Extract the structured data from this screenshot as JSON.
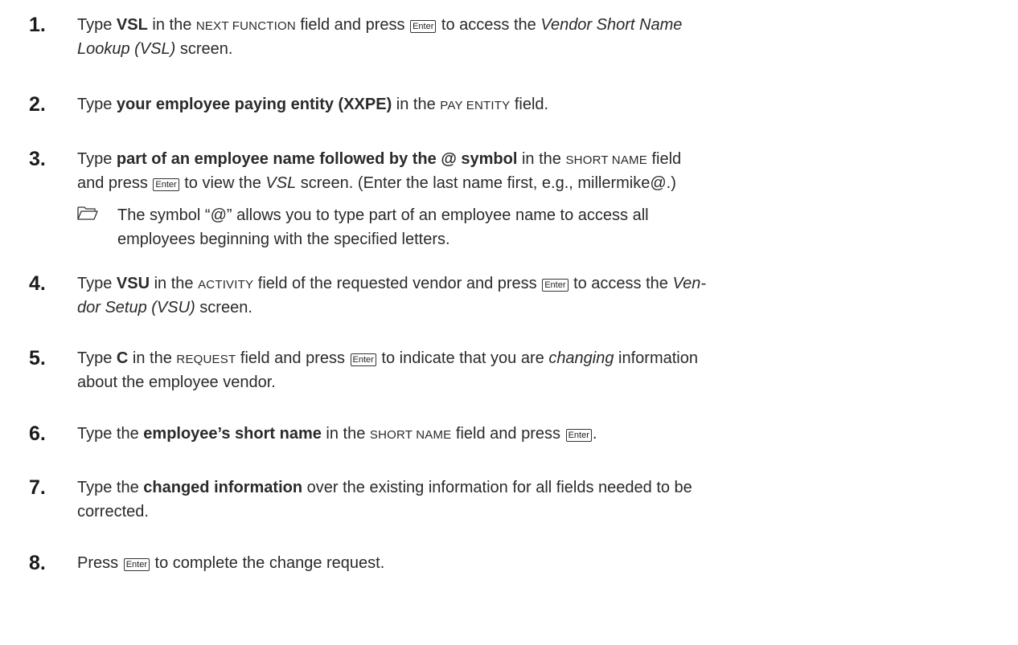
{
  "steps": [
    {
      "num": "1.",
      "parts": [
        "Type ",
        "VSL",
        " in the ",
        "NEXT FUNCTION",
        " field and press ",
        "Enter",
        " to access the ",
        "Vendor Short Name",
        "Lookup (VSL)",
        " screen."
      ]
    },
    {
      "num": "2.",
      "parts": [
        "Type ",
        "your employee paying entity (XXPE)",
        " in the ",
        "PAY ENTITY",
        " field."
      ]
    },
    {
      "num": "3.",
      "parts": [
        "Type ",
        "part of an employee name followed by the @ symbol",
        " in the ",
        "SHORT NAME",
        " field",
        "and press ",
        "Enter",
        " to view the ",
        "VSL",
        " screen.  (Enter the last name first, e.g., millermike@.)"
      ],
      "note": {
        "icon": "folder-icon",
        "line1": "The symbol “@” allows you to type part of an employee name to access all",
        "line2": "employees beginning with the specified letters."
      }
    },
    {
      "num": "4.",
      "parts": [
        "Type ",
        "VSU",
        " in the ",
        "ACTIVITY",
        " field of the requested vendor and press ",
        "Enter",
        " to access the ",
        "Ven-",
        "dor Setup (VSU)",
        " screen."
      ]
    },
    {
      "num": "5.",
      "parts": [
        "Type ",
        "C",
        " in the ",
        "REQUEST",
        " field and press ",
        "Enter",
        " to indicate that you are ",
        "changing",
        " information",
        "about the employee vendor."
      ]
    },
    {
      "num": "6.",
      "parts": [
        "Type the ",
        "employee’s short name",
        " in the ",
        "SHORT NAME",
        " field and press ",
        "Enter",
        "."
      ]
    },
    {
      "num": "7.",
      "parts": [
        "Type the ",
        "changed information",
        " over the existing information for all fields needed to be",
        "corrected."
      ]
    },
    {
      "num": "8.",
      "parts": [
        "Press ",
        "Enter",
        " to complete the change request."
      ]
    }
  ]
}
